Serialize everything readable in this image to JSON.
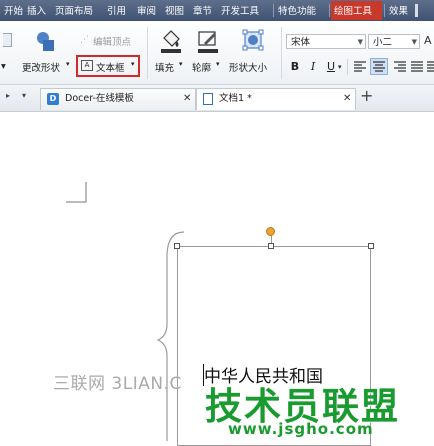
{
  "menu": {
    "items": [
      "开始",
      "插入",
      "页面布局",
      "引用",
      "审阅",
      "视图",
      "章节",
      "开发工具",
      "特色功能",
      "绘图工具",
      "效果"
    ]
  },
  "ribbon": {
    "change_shape_label": "更改形状",
    "edit_vertices_label": "编辑顶点",
    "textbox_label": "文本框",
    "fill_label": "填充",
    "outline_label": "轮廓",
    "shape_size_label": "形状大小",
    "font_name": "宋体",
    "font_size": "小二",
    "bold": "B",
    "italic": "I",
    "underline": "U"
  },
  "tabs": [
    {
      "label": "Docer-在线模板"
    },
    {
      "label": "文档1 *"
    }
  ],
  "tab_add": "+",
  "document": {
    "textbox_text": "中华人民共和国"
  },
  "watermark": {
    "left_text": "三联网 3LIAN.C",
    "brand_text": "技术员联盟",
    "url_text": "www.jsgho.com"
  },
  "colors": {
    "menubar": "#4a5b78",
    "active_menu": "#c9392b",
    "highlight_border": "#d02a2a",
    "brand_green": "#1a9b2f",
    "handle_orange": "#f0a030"
  }
}
